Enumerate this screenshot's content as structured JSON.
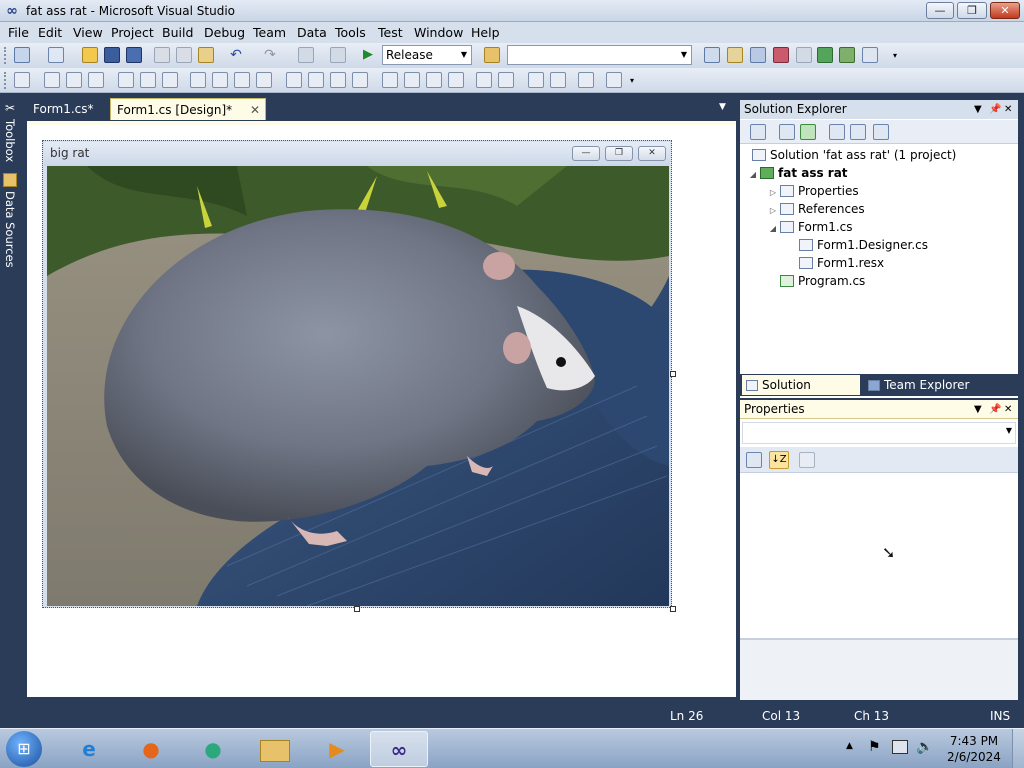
{
  "window": {
    "title": "fat ass rat - Microsoft Visual Studio",
    "controls": {
      "minimize": "—",
      "maximize": "❐",
      "close": "✕"
    }
  },
  "menu": [
    "File",
    "Edit",
    "View",
    "Project",
    "Build",
    "Debug",
    "Team",
    "Data",
    "Tools",
    "Test",
    "Window",
    "Help"
  ],
  "toolbar": {
    "config_value": "Release",
    "platform_value": ""
  },
  "left_dock": {
    "toolbox": "Toolbox",
    "data_sources": "Data Sources"
  },
  "document_tabs": [
    {
      "label": "Form1.cs*",
      "active": false
    },
    {
      "label": "Form1.cs [Design]*",
      "active": true
    }
  ],
  "designer": {
    "form_title": "big rat",
    "picture": "photo of a large grey rat sitting on blue jeans"
  },
  "solution_explorer": {
    "title": "Solution Explorer",
    "tree": [
      {
        "label": "Solution 'fat ass rat' (1 project)",
        "icon": "solution-icon"
      },
      {
        "label": "fat ass rat",
        "icon": "csharp-project-icon"
      },
      {
        "label": "Properties",
        "icon": "properties-folder-icon"
      },
      {
        "label": "References",
        "icon": "references-folder-icon"
      },
      {
        "label": "Form1.cs",
        "icon": "form-file-icon"
      },
      {
        "label": "Form1.Designer.cs",
        "icon": "cs-file-icon"
      },
      {
        "label": "Form1.resx",
        "icon": "resx-file-icon"
      },
      {
        "label": "Program.cs",
        "icon": "cs-file-icon"
      }
    ]
  },
  "bottom_tabs": [
    "Solution Explorer",
    "Team Explorer"
  ],
  "properties_panel": {
    "title": "Properties",
    "object_value": ""
  },
  "status": {
    "line": "Ln 26",
    "col": "Col 13",
    "ch": "Ch 13",
    "mode": "INS"
  },
  "taskbar": {
    "time": "7:43 PM",
    "date": "2/6/2024",
    "apps": [
      "Internet Explorer",
      "Firefox",
      "Messenger",
      "Windows Explorer",
      "Media Player",
      "Visual Studio"
    ]
  },
  "colors": {
    "chrome": "#2b3c59",
    "active_tab": "#fefbe6",
    "accent": "#d6dfec"
  }
}
